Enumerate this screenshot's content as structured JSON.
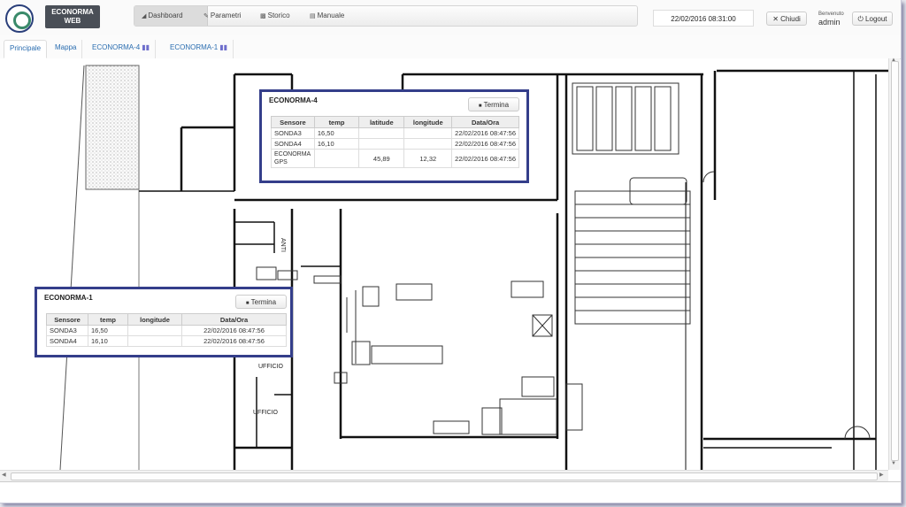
{
  "header": {
    "brand": "ECONORMA\nWEB",
    "nav": [
      {
        "label": "Dashboard",
        "icon": "dashboard-icon"
      },
      {
        "label": "Parametri",
        "icon": "wrench-icon"
      },
      {
        "label": "Storico",
        "icon": "storage-icon"
      },
      {
        "label": "Manuale",
        "icon": "book-icon"
      }
    ],
    "datetime": "22/02/2016 08:31:00",
    "close_label": "Chiudi",
    "welcome": "Benvenuto",
    "username": "admin",
    "logout_label": "Logout"
  },
  "tabs": [
    {
      "label": "Principale"
    },
    {
      "label": "Mappa"
    },
    {
      "label": "ECONORMA-4"
    },
    {
      "label": "ECONORMA-1"
    }
  ],
  "map": {
    "labels": {
      "anti": "ANTI",
      "ufficio1": "UFFICIO",
      "ufficio2": "UFFICIO"
    }
  },
  "panels": [
    {
      "title": "ECONORMA-4",
      "button": "Termina",
      "columns": [
        "Sensore",
        "temp",
        "latitude",
        "longitude",
        "Data/Ora"
      ],
      "rows": [
        [
          "SONDA3",
          "16,50",
          "",
          "",
          "22/02/2016 08:47:56"
        ],
        [
          "SONDA4",
          "16,10",
          "",
          "",
          "22/02/2016 08:47:56"
        ],
        [
          "ECONORMA GPS",
          "",
          "45,89",
          "12,32",
          "22/02/2016 08:47:56"
        ]
      ]
    },
    {
      "title": "ECONORMA-1",
      "button": "Termina",
      "columns": [
        "Sensore",
        "temp",
        "longitude",
        "Data/Ora"
      ],
      "rows": [
        [
          "SONDA3",
          "16,50",
          "",
          "22/02/2016 08:47:56"
        ],
        [
          "SONDA4",
          "16,10",
          "",
          "22/02/2016 08:47:56"
        ]
      ]
    }
  ]
}
